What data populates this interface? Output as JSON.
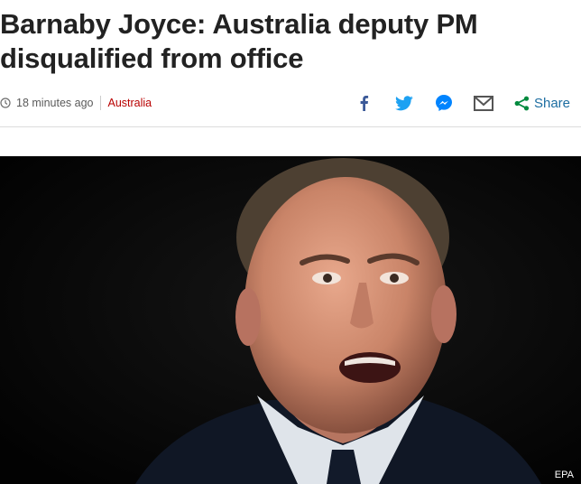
{
  "article": {
    "headline": "Barnaby Joyce: Australia deputy PM disqualified from office"
  },
  "meta": {
    "timestamp": "18 minutes ago",
    "section": "Australia"
  },
  "share": {
    "label": "Share",
    "icons": [
      "facebook-icon",
      "twitter-icon",
      "messenger-icon",
      "email-icon",
      "share-icon"
    ]
  },
  "image": {
    "credit": "EPA"
  },
  "colors": {
    "headline": "#222222",
    "section_link": "#b80000",
    "facebook": "#3b5998",
    "twitter": "#1da1f2",
    "messenger": "#0084ff",
    "share": "#1c6da1",
    "share_icon": "#008a3e"
  }
}
